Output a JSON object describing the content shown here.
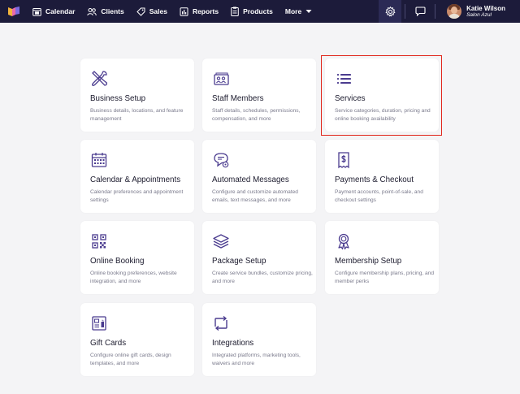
{
  "nav": {
    "items": [
      {
        "label": "Calendar",
        "icon": "calendar-icon"
      },
      {
        "label": "Clients",
        "icon": "clients-icon"
      },
      {
        "label": "Sales",
        "icon": "tag-icon"
      },
      {
        "label": "Reports",
        "icon": "reports-icon"
      },
      {
        "label": "Products",
        "icon": "clipboard-icon"
      },
      {
        "label": "More",
        "icon": "chevron-down-icon"
      }
    ]
  },
  "user": {
    "name": "Katie Wilson",
    "salon": "Salon Azul"
  },
  "colors": {
    "topbar": "#1c1b3a",
    "accent": "#4b3c8f",
    "highlight": "#e1261c"
  },
  "cards": [
    {
      "title": "Business Setup",
      "desc": "Business details, locations, and feature management",
      "icon": "tools-icon"
    },
    {
      "title": "Staff Members",
      "desc": "Staff details, schedules, permissions, compensation, and more",
      "icon": "staff-icon"
    },
    {
      "title": "Services",
      "desc": "Service categories, duration, pricing and online booking availability",
      "icon": "list-icon"
    },
    {
      "title": "Calendar & Appointments",
      "desc": "Calendar preferences and appointment settings",
      "icon": "calendar-grid-icon"
    },
    {
      "title": "Automated Messages",
      "desc": "Configure and customize automated emails, text messages, and more",
      "icon": "message-gear-icon"
    },
    {
      "title": "Payments & Checkout",
      "desc": "Payment accounts, point-of-sale, and checkout settings",
      "icon": "dollar-receipt-icon"
    },
    {
      "title": "Online Booking",
      "desc": "Online booking preferences, website integration, and more",
      "icon": "qr-code-icon"
    },
    {
      "title": "Package Setup",
      "desc": "Create service bundles, customize pricing, and more",
      "icon": "layers-icon"
    },
    {
      "title": "Membership Setup",
      "desc": "Configure membership plans, pricing, and member perks",
      "icon": "award-icon"
    },
    {
      "title": "Gift Cards",
      "desc": "Configure online gift cards, design templates, and more",
      "icon": "gift-card-icon"
    },
    {
      "title": "Integrations",
      "desc": "Integrated platforms, marketing tools, waivers and more",
      "icon": "integrations-icon"
    }
  ]
}
